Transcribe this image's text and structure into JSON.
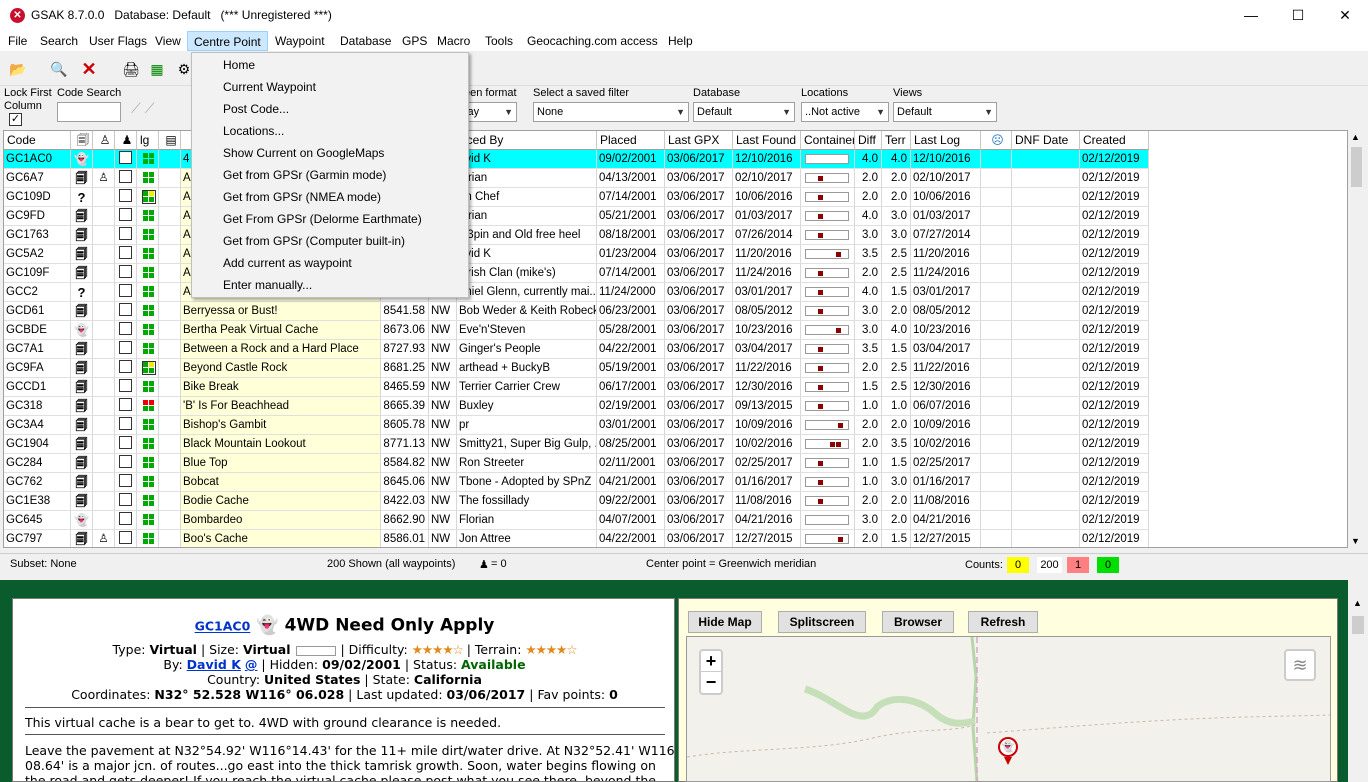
{
  "window": {
    "title": "GSAK 8.7.0.0   Database: Default   (*** Unregistered ***)",
    "minimize": "—",
    "maximize": "☐",
    "close": "✕"
  },
  "menu": [
    "File",
    "Search",
    "User Flags",
    "View",
    "Centre Point",
    "Waypoint",
    "Database",
    "GPS",
    "Macro",
    "Tools",
    "Geocaching.com access",
    "Help"
  ],
  "centre_point_menu": [
    "Home",
    "Current Waypoint",
    "Post Code...",
    "Locations...",
    "Show Current on GoogleMaps",
    "Get from GPSr (Garmin mode)",
    "Get from GPSr (NMEA mode)",
    "Get From GPSr (Delorme Earthmate)",
    "Get from GPSr (Computer built-in)",
    "Add current as waypoint",
    "Enter manually..."
  ],
  "filters": {
    "lock_first": "Lock First",
    "column": "Column",
    "code_search": "Code Search",
    "screen_format_label": "een format",
    "screen_format_value": "play",
    "saved_filter_label": "Select a saved filter",
    "saved_filter_value": "None",
    "database_label": "Database",
    "database_value": "Default",
    "locations_label": "Locations",
    "locations_value": "..Not active",
    "views_label": "Views",
    "views_value": "Default"
  },
  "columns": {
    "code": "Code",
    "lg": "lg",
    "placed_by": "aced By",
    "placed": "Placed",
    "last_gpx": "Last GPX",
    "last_found": "Last Found",
    "container": "Container",
    "diff": "Diff",
    "terr": "Terr",
    "last_log": "Last Log",
    "dnf_date": "DNF Date",
    "created": "Created"
  },
  "rows": [
    {
      "code": "GC1AC0",
      "type": "virtual",
      "person": false,
      "sq": "g",
      "name": "4",
      "dist": "",
      "dir": "",
      "by": "avid K",
      "placed": "09/02/2001",
      "gpx": "03/06/2017",
      "found": "12/10/2016",
      "cont": "v",
      "diff": "4.0",
      "terr": "4.0",
      "log": "12/10/2016",
      "created": "02/12/2019",
      "sel": true
    },
    {
      "code": "GC6A7",
      "type": "trad",
      "person": true,
      "sq": "g",
      "name": "A",
      "dist": "",
      "dir": "",
      "by": "lorian",
      "placed": "04/13/2001",
      "gpx": "03/06/2017",
      "found": "02/10/2017",
      "cont": "r",
      "diff": "2.0",
      "terr": "2.0",
      "log": "02/10/2017",
      "created": "02/12/2019"
    },
    {
      "code": "GC109D",
      "type": "mystery",
      "person": false,
      "sq": "y",
      "name": "A",
      "dist": "",
      "dir": "",
      "by": "on Chef",
      "placed": "07/14/2001",
      "gpx": "03/06/2017",
      "found": "10/06/2016",
      "cont": "r",
      "diff": "2.0",
      "terr": "2.0",
      "log": "10/06/2016",
      "created": "02/12/2019"
    },
    {
      "code": "GC9FD",
      "type": "trad",
      "person": false,
      "sq": "g",
      "name": "A",
      "dist": "",
      "dir": "",
      "by": "lorian",
      "placed": "05/21/2001",
      "gpx": "03/06/2017",
      "found": "01/03/2017",
      "cont": "r",
      "diff": "4.0",
      "terr": "3.0",
      "log": "01/03/2017",
      "created": "02/12/2019"
    },
    {
      "code": "GC1763",
      "type": "trad",
      "person": false,
      "sq": "g",
      "name": "A",
      "dist": "",
      "dir": "",
      "by": "ki3pin and Old free heel",
      "placed": "08/18/2001",
      "gpx": "03/06/2017",
      "found": "07/26/2014",
      "cont": "r",
      "diff": "3.0",
      "terr": "3.0",
      "log": "07/27/2014",
      "created": "02/12/2019"
    },
    {
      "code": "GC5A2",
      "type": "trad",
      "person": false,
      "sq": "g",
      "name": "A",
      "dist": "",
      "dir": "",
      "by": "avid K",
      "placed": "01/23/2004",
      "gpx": "03/06/2017",
      "found": "11/20/2016",
      "cont": "q",
      "diff": "3.5",
      "terr": "2.5",
      "log": "11/20/2016",
      "created": "02/12/2019"
    },
    {
      "code": "GC109F",
      "type": "trad",
      "person": false,
      "sq": "g",
      "name": "A",
      "dist": "",
      "dir": "",
      "by": "clrish Clan (mike's)",
      "placed": "07/14/2001",
      "gpx": "03/06/2017",
      "found": "11/24/2016",
      "cont": "r",
      "diff": "2.0",
      "terr": "2.5",
      "log": "11/24/2016",
      "created": "02/12/2019"
    },
    {
      "code": "GCC2",
      "type": "mystery",
      "person": false,
      "sq": "g",
      "name": "A",
      "dist": "",
      "dir": "",
      "by": "aniel Glenn, currently mai...",
      "placed": "11/24/2000",
      "gpx": "03/06/2017",
      "found": "03/01/2017",
      "cont": "r",
      "diff": "4.0",
      "terr": "1.5",
      "log": "03/01/2017",
      "created": "02/12/2019"
    },
    {
      "code": "GCD61",
      "type": "trad",
      "person": false,
      "sq": "g",
      "name": "Berryessa or Bust!",
      "dist": "8541.58",
      "dir": "NW",
      "by": "Bob Weder & Keith Robeck",
      "placed": "06/23/2001",
      "gpx": "03/06/2017",
      "found": "08/05/2012",
      "cont": "r",
      "diff": "3.0",
      "terr": "2.0",
      "log": "08/05/2012",
      "created": "02/12/2019"
    },
    {
      "code": "GCBDE",
      "type": "virtual",
      "person": false,
      "sq": "g",
      "name": "Bertha Peak Virtual Cache",
      "dist": "8673.06",
      "dir": "NW",
      "by": "Eve'n'Steven",
      "placed": "05/28/2001",
      "gpx": "03/06/2017",
      "found": "10/23/2016",
      "cont": "q",
      "diff": "3.0",
      "terr": "4.0",
      "log": "10/23/2016",
      "created": "02/12/2019"
    },
    {
      "code": "GC7A1",
      "type": "trad",
      "person": false,
      "sq": "g",
      "name": "Between a Rock and a Hard Place",
      "dist": "8727.93",
      "dir": "NW",
      "by": "Ginger's People",
      "placed": "04/22/2001",
      "gpx": "03/06/2017",
      "found": "03/04/2017",
      "cont": "r",
      "diff": "3.5",
      "terr": "1.5",
      "log": "03/04/2017",
      "created": "02/12/2019"
    },
    {
      "code": "GC9FA",
      "type": "trad",
      "person": false,
      "sq": "y",
      "name": "Beyond Castle Rock",
      "dist": "8681.25",
      "dir": "NW",
      "by": "arthead + BuckyB",
      "placed": "05/19/2001",
      "gpx": "03/06/2017",
      "found": "11/22/2016",
      "cont": "r",
      "diff": "2.0",
      "terr": "2.5",
      "log": "11/22/2016",
      "created": "02/12/2019"
    },
    {
      "code": "GCCD1",
      "type": "trad",
      "person": false,
      "sq": "g",
      "name": "Bike Break",
      "dist": "8465.59",
      "dir": "NW",
      "by": "Terrier Carrier Crew",
      "placed": "06/17/2001",
      "gpx": "03/06/2017",
      "found": "12/30/2016",
      "cont": "r",
      "diff": "1.5",
      "terr": "2.5",
      "log": "12/30/2016",
      "created": "02/12/2019"
    },
    {
      "code": "GC318",
      "type": "trad",
      "person": false,
      "sq": "r",
      "name": "'B' Is For Beachhead",
      "dist": "8665.39",
      "dir": "NW",
      "by": "Buxley",
      "placed": "02/19/2001",
      "gpx": "03/06/2017",
      "found": "09/13/2015",
      "cont": "r",
      "diff": "1.0",
      "terr": "1.0",
      "log": "06/07/2016",
      "created": "02/12/2019"
    },
    {
      "code": "GC3A4",
      "type": "trad",
      "person": false,
      "sq": "g",
      "name": "Bishop's Gambit",
      "dist": "8605.78",
      "dir": "NW",
      "by": "pr",
      "placed": "03/01/2001",
      "gpx": "03/06/2017",
      "found": "10/09/2016",
      "cont": "x",
      "diff": "2.0",
      "terr": "2.0",
      "log": "10/09/2016",
      "created": "02/12/2019"
    },
    {
      "code": "GC1904",
      "type": "trad",
      "person": false,
      "sq": "g",
      "name": "Black Mountain Lookout",
      "dist": "8771.13",
      "dir": "NW",
      "by": "Smitty21, Super Big Gulp, ...",
      "placed": "08/25/2001",
      "gpx": "03/06/2017",
      "found": "10/02/2016",
      "cont": "l",
      "diff": "2.0",
      "terr": "3.5",
      "log": "10/02/2016",
      "created": "02/12/2019"
    },
    {
      "code": "GC284",
      "type": "trad",
      "person": false,
      "sq": "g",
      "name": "Blue Top",
      "dist": "8584.82",
      "dir": "NW",
      "by": "Ron Streeter",
      "placed": "02/11/2001",
      "gpx": "03/06/2017",
      "found": "02/25/2017",
      "cont": "r",
      "diff": "1.0",
      "terr": "1.5",
      "log": "02/25/2017",
      "created": "02/12/2019"
    },
    {
      "code": "GC762",
      "type": "trad",
      "person": false,
      "sq": "g",
      "name": "Bobcat",
      "dist": "8645.06",
      "dir": "NW",
      "by": "Tbone - Adopted by SPnZ",
      "placed": "04/21/2001",
      "gpx": "03/06/2017",
      "found": "01/16/2017",
      "cont": "r",
      "diff": "1.0",
      "terr": "3.0",
      "log": "01/16/2017",
      "created": "02/12/2019"
    },
    {
      "code": "GC1E38",
      "type": "trad",
      "person": false,
      "sq": "g",
      "name": "Bodie Cache",
      "dist": "8422.03",
      "dir": "NW",
      "by": "The fossillady",
      "placed": "09/22/2001",
      "gpx": "03/06/2017",
      "found": "11/08/2016",
      "cont": "r",
      "diff": "2.0",
      "terr": "2.0",
      "log": "11/08/2016",
      "created": "02/12/2019"
    },
    {
      "code": "GC645",
      "type": "virtual",
      "person": false,
      "sq": "g",
      "name": "Bombardeo",
      "dist": "8662.90",
      "dir": "NW",
      "by": "Florian",
      "placed": "04/07/2001",
      "gpx": "03/06/2017",
      "found": "04/21/2016",
      "cont": "v",
      "diff": "3.0",
      "terr": "2.0",
      "log": "04/21/2016",
      "created": "02/12/2019"
    },
    {
      "code": "GC797",
      "type": "trad",
      "person": true,
      "sq": "g",
      "name": "Boo's Cache",
      "dist": "8586.01",
      "dir": "NW",
      "by": "Jon Attree",
      "placed": "04/22/2001",
      "gpx": "03/06/2017",
      "found": "12/27/2015",
      "cont": "x",
      "diff": "2.0",
      "terr": "1.5",
      "log": "12/27/2015",
      "created": "02/12/2019"
    }
  ],
  "status": {
    "subset": "Subset: None",
    "shown": "200 Shown (all waypoints)",
    "found_eq": "= 0",
    "center": "Center point = Greenwich meridian",
    "counts_label": "Counts:",
    "count_yellow": "0",
    "count_white": "200",
    "count_red": "1",
    "count_green": "0"
  },
  "detail": {
    "code": "GC1AC0",
    "name": "4WD Need Only Apply",
    "type_label": "Type:",
    "type": "Virtual",
    "size_label": "Size:",
    "size": "Virtual",
    "difficulty_label": "Difficulty:",
    "difficulty_stars": "★★★★☆",
    "terrain_label": "Terrain:",
    "terrain_stars": "★★★★☆",
    "by_label": "By:",
    "by": "David K",
    "hidden_label": "Hidden:",
    "hidden": "09/02/2001",
    "status_label": "Status:",
    "status": "Available",
    "country_label": "Country:",
    "country": "United States",
    "state_label": "State:",
    "state": "California",
    "coords_label": "Coordinates:",
    "coords": "N32° 52.528 W116° 06.028",
    "updated_label": "Last updated:",
    "updated": "03/06/2017",
    "fav_label": "Fav points:",
    "fav": "0",
    "short_desc": "This virtual cache is a bear to get to. 4WD with ground clearance is needed.",
    "long_desc_1": "Leave the pavement at N32°54.92' W116°14.43' for the 11+ mile dirt/water drive. At N32°52.41' W116°",
    "long_desc_2": "08.64' is a major jcn. of routes...go east into the thick tamrisk growth. Soon, water begins flowing on",
    "long_desc_3": "the road and gets deeper! If you reach the virtual cache please post what you see there, beyond the"
  },
  "map_buttons": {
    "hide": "Hide Map",
    "split": "Splitscreen",
    "browser": "Browser",
    "refresh": "Refresh",
    "zoom_in": "+",
    "zoom_out": "−"
  },
  "colors": {
    "selected_row": "#00ffff",
    "name_cell": "#ffffd8",
    "lower_frame": "#0a5c2c",
    "status_available": "#006400"
  }
}
